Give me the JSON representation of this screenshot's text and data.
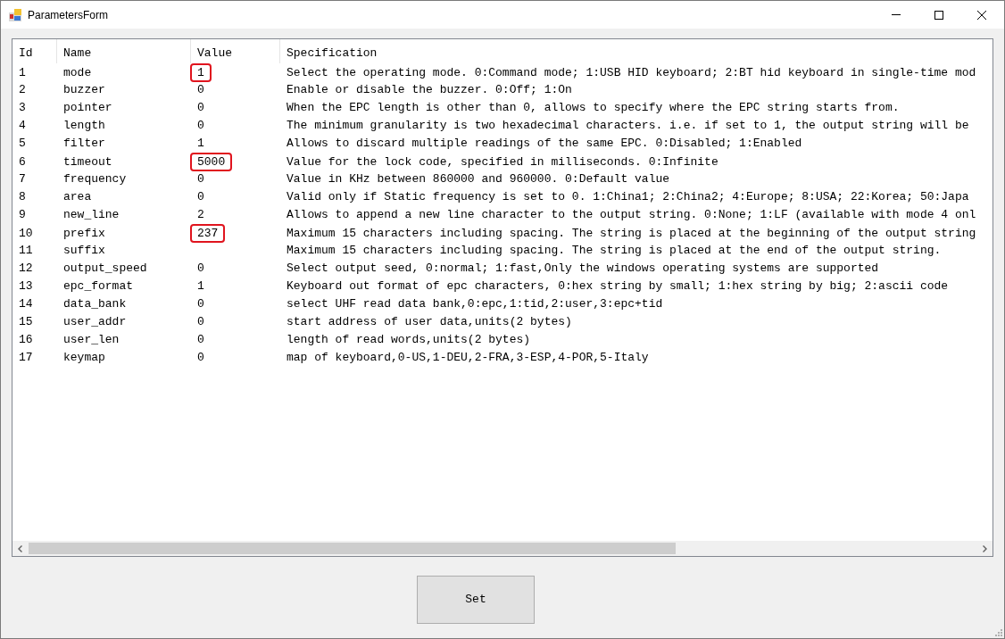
{
  "window": {
    "title": "ParametersForm"
  },
  "table": {
    "columns": [
      "Id",
      "Name",
      "Value",
      "Specification"
    ],
    "rows": [
      {
        "id": "1",
        "name": "mode",
        "value": "1",
        "highlighted": true,
        "specification": "Select the operating mode. 0:Command mode; 1:USB HID keyboard; 2:BT hid keyboard in single-time mod"
      },
      {
        "id": "2",
        "name": "buzzer",
        "value": "0",
        "highlighted": false,
        "specification": "Enable or disable the buzzer. 0:Off; 1:On"
      },
      {
        "id": "3",
        "name": "pointer",
        "value": "0",
        "highlighted": false,
        "specification": "When the EPC length is other than 0, allows to specify where the EPC string starts from."
      },
      {
        "id": "4",
        "name": "length",
        "value": "0",
        "highlighted": false,
        "specification": "The minimum granularity is two hexadecimal characters. i.e. if set to 1, the output string will be"
      },
      {
        "id": "5",
        "name": "filter",
        "value": "1",
        "highlighted": false,
        "specification": "Allows to discard multiple readings of the same EPC. 0:Disabled; 1:Enabled"
      },
      {
        "id": "6",
        "name": "timeout",
        "value": "5000",
        "highlighted": true,
        "specification": "Value for the lock code, specified in milliseconds. 0:Infinite"
      },
      {
        "id": "7",
        "name": "frequency",
        "value": "0",
        "highlighted": false,
        "specification": "Value in KHz between 860000 and 960000. 0:Default value"
      },
      {
        "id": "8",
        "name": "area",
        "value": "0",
        "highlighted": false,
        "specification": "Valid only if Static frequency is set to 0. 1:China1; 2:China2; 4:Europe; 8:USA; 22:Korea; 50:Japa"
      },
      {
        "id": "9",
        "name": "new_line",
        "value": "2",
        "highlighted": false,
        "specification": "Allows to append a new line character to the output string. 0:None; 1:LF (available with mode 4 onl"
      },
      {
        "id": "10",
        "name": "prefix",
        "value": "237",
        "highlighted": true,
        "specification": "Maximum 15 characters including spacing. The string is placed at the beginning of the output string"
      },
      {
        "id": "11",
        "name": "suffix",
        "highlighted": false,
        "specification": "Maximum 15 characters including spacing. The string is placed at the end of the output string."
      },
      {
        "id": "12",
        "name": "output_speed",
        "value": "0",
        "highlighted": false,
        "specification": "Select output seed, 0:normal; 1:fast,Only the windows operating systems are supported"
      },
      {
        "id": "13",
        "name": "epc_format",
        "value": "1",
        "highlighted": false,
        "specification": "Keyboard out format of epc characters, 0:hex string by small; 1:hex string by big; 2:ascii code"
      },
      {
        "id": "14",
        "name": "data_bank",
        "value": "0",
        "highlighted": false,
        "specification": "select UHF read data bank,0:epc,1:tid,2:user,3:epc+tid"
      },
      {
        "id": "15",
        "name": "user_addr",
        "value": "0",
        "highlighted": false,
        "specification": "start address of user data,units(2 bytes)"
      },
      {
        "id": "16",
        "name": "user_len",
        "value": "0",
        "highlighted": false,
        "specification": "length of read words,units(2 bytes)"
      },
      {
        "id": "17",
        "name": "keymap",
        "value": "0",
        "highlighted": false,
        "specification": "map of keyboard,0-US,1-DEU,2-FRA,3-ESP,4-POR,5-Italy"
      }
    ]
  },
  "set_button": {
    "label": "Set"
  }
}
